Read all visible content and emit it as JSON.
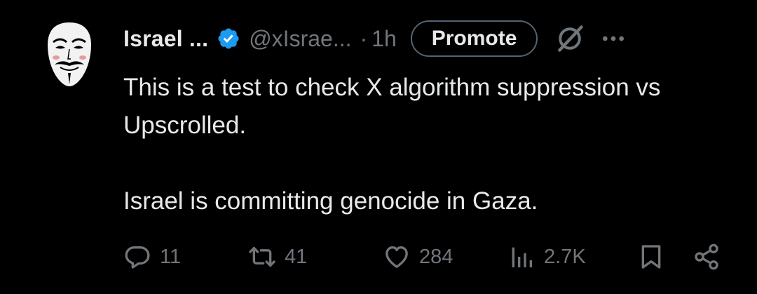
{
  "author": {
    "name": "Israel ...",
    "handle": "@xIsrae...",
    "separator": "·",
    "time": "1h",
    "verified": true,
    "avatar_icon": "guy-fawkes-mask-icon"
  },
  "header": {
    "promote_label": "Promote",
    "grok_icon": "grok-icon",
    "more_icon": "more-dots-icon"
  },
  "tweet": {
    "line1": "This is a test to check X algorithm suppression vs Upscrolled.",
    "line2": "Israel is committing genocide in Gaza."
  },
  "actions": {
    "replies": "11",
    "retweets": "41",
    "likes": "284",
    "views": "2.7K"
  },
  "colors": {
    "background": "#000000",
    "text": "#e7e9ea",
    "muted": "#71767b",
    "verified": "#1d9bf0"
  }
}
